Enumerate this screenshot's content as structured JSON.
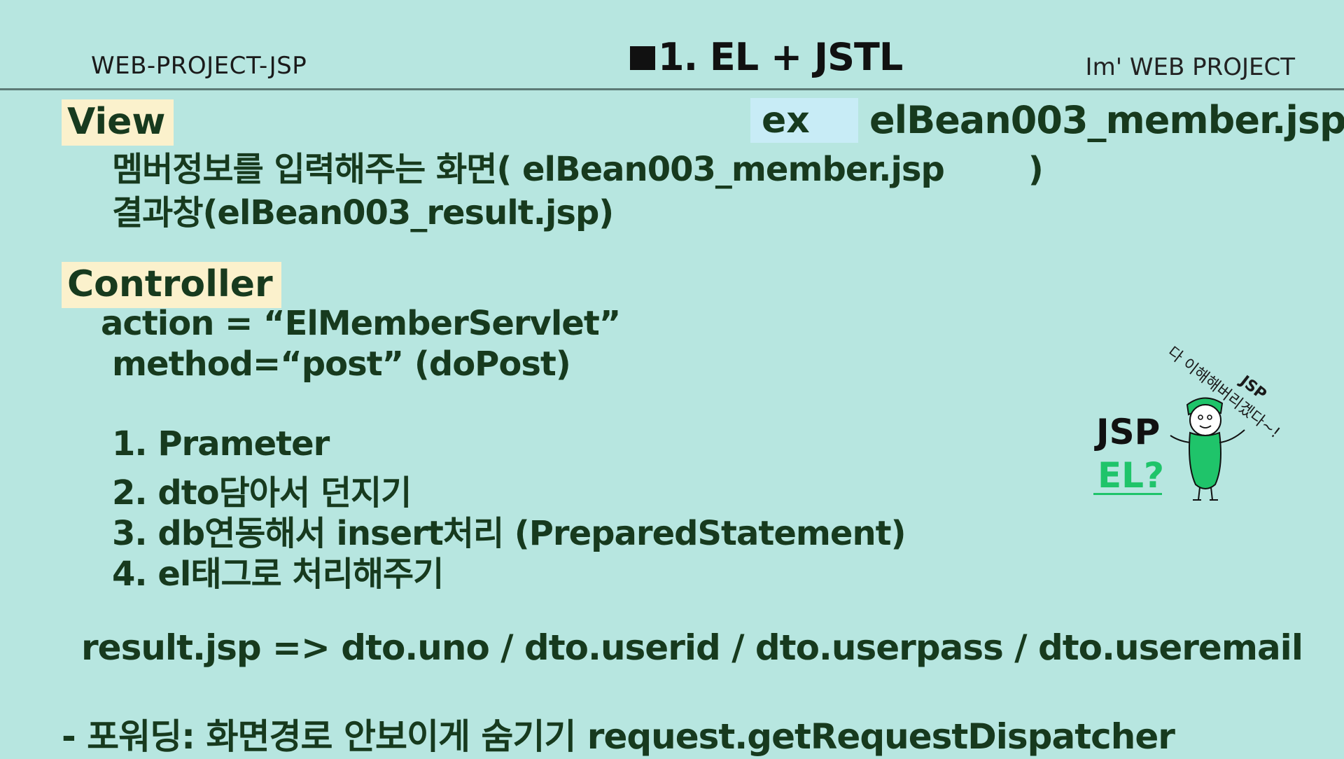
{
  "header": {
    "left": "WEB-PROJECT-JSP",
    "title": "1. EL + JSTL",
    "right": "Im'  WEB PROJECT"
  },
  "view": {
    "tag": "View",
    "ex_label": "ex",
    "ex_file": "elBean003_member.jsp",
    "line1_text": "멤버정보를 입력해주는 화면(  elBean003_member.jsp",
    "line1_close": ")",
    "line2": "결과창(elBean003_result.jsp)"
  },
  "controller": {
    "tag": "Controller",
    "action": "action = “ElMemberServlet”",
    "method": "method=“post” (doPost)",
    "steps": [
      "1. Prameter",
      "2. dto담아서 던지기",
      "3. db연동해서 insert처리 (PreparedStatement)",
      "4. el태그로 처리해주기"
    ]
  },
  "result_line": "result.jsp => dto.uno / dto.userid / dto.userpass / dto.useremail",
  "forward_line": "- 포워딩: 화면경로 안보이게 숨기기 request.getRequestDispatcher",
  "mascot": {
    "jsp": "JSP",
    "el": "EL?",
    "bubble": "다 이해해버리겠다~!",
    "bubble_jsp": "JSP"
  },
  "colors": {
    "background": "#b7e6e0",
    "text": "#173a1e",
    "tag_highlight": "#fbf1cc",
    "ex_highlight": "#c8ecf6",
    "accent_green": "#1fc46a"
  }
}
